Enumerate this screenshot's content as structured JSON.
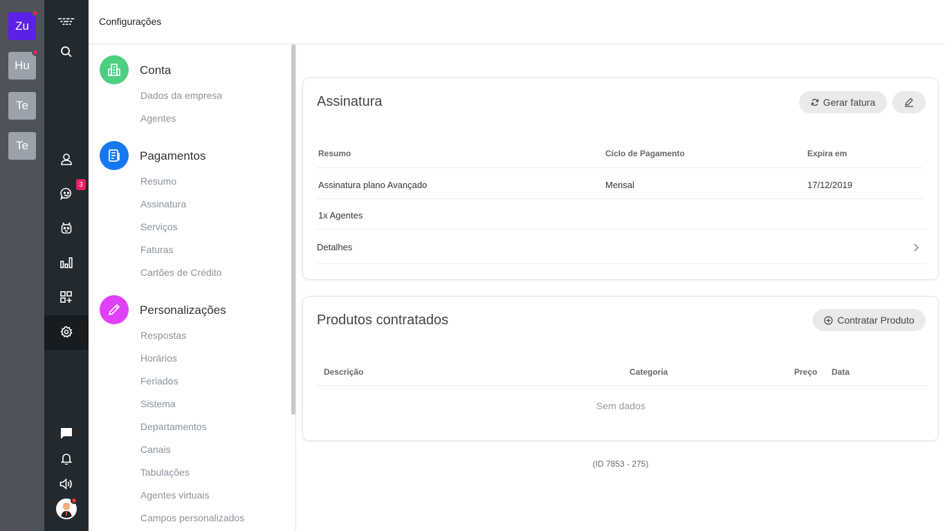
{
  "workspaces": [
    {
      "label": "Zu",
      "color": "#5b21e8",
      "dot": true
    },
    {
      "label": "Hu",
      "color": "#9aa3ab",
      "dot": true
    },
    {
      "label": "Te",
      "color": "#9aa3ab",
      "dot": false
    },
    {
      "label": "Te",
      "color": "#9aa3ab",
      "dot": false
    }
  ],
  "nav": {
    "chat_badge": "3",
    "icons": [
      "logo-icon",
      "search-icon",
      "contacts-icon",
      "chat-icon",
      "bot-icon",
      "reports-icon",
      "apps-icon",
      "settings-icon",
      "messages-icon",
      "notifications-icon",
      "sound-icon"
    ]
  },
  "topbar": {
    "title": "Configurações"
  },
  "menu": {
    "sections": [
      {
        "title": "Conta",
        "color": "#4cd080",
        "items": [
          "Dados da empresa",
          "Agentes"
        ]
      },
      {
        "title": "Pagamentos",
        "color": "#1677f0",
        "items": [
          "Resumo",
          "Assinatura",
          "Serviços",
          "Faturas",
          "Cartões de Crédito"
        ]
      },
      {
        "title": "Personalizações",
        "color": "#e040fb",
        "items": [
          "Respostas",
          "Horários",
          "Feriados",
          "Sistema",
          "Departamentos",
          "Canais",
          "Tabulações",
          "Agentes virtuais",
          "Campos personalizados"
        ]
      }
    ]
  },
  "subscription": {
    "title": "Assinatura",
    "invoice_button": "Gerar fatura",
    "headers": {
      "summary": "Resumo",
      "cycle": "Ciclo de Pagamento",
      "expires": "Expira em"
    },
    "rows": [
      {
        "summary": "Assinatura plano Avançado",
        "cycle": "Mensal",
        "expires": "17/12/2019"
      },
      {
        "summary": "1x Agentes",
        "cycle": "",
        "expires": ""
      }
    ],
    "details": "Detalhes"
  },
  "products": {
    "title": "Produtos contratados",
    "add_button": "Contratar Produto",
    "headers": {
      "description": "Descrição",
      "category": "Categoria",
      "price": "Preço",
      "date": "Data"
    },
    "empty": "Sem dados"
  },
  "footer": {
    "id": "(ID 7853 - 275)"
  }
}
